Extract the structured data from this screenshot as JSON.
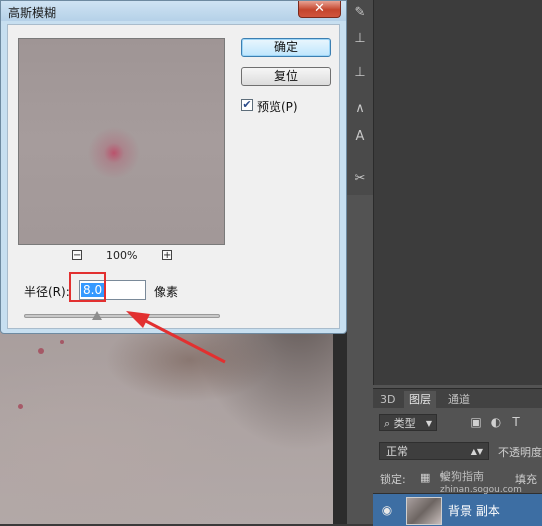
{
  "dialog": {
    "title": "高斯模糊",
    "close_glyph": "✕",
    "ok_label": "确定",
    "reset_label": "复位",
    "preview_checkbox": {
      "label": "预览(P)",
      "checked": true,
      "check_glyph": "✔"
    },
    "zoom": {
      "minus_glyph": "−",
      "value": "100%",
      "plus_glyph": "+"
    },
    "radius": {
      "label": "半径(R):",
      "value": "8.0",
      "unit": "像素",
      "slider_fraction": 0.37
    }
  },
  "layers_panel": {
    "tabs": [
      "3D",
      "图层",
      "通道"
    ],
    "active_tab": 1,
    "filter_kind": "类型",
    "blend_mode": "正常",
    "opacity_label": "不透明度",
    "lock_label": "锁定:",
    "fill_label": "填充",
    "layer": {
      "name": "背景 副本",
      "visible": true
    }
  },
  "watermark": {
    "line1": "搜狗指南",
    "line2": "zhinan.sogou.com"
  },
  "icons": {
    "close": "close-icon",
    "eye": "eye-icon",
    "search": "search-icon",
    "image_filter": "image-filter-icon",
    "adjustment_filter": "adjustment-filter-icon",
    "type_filter": "type-filter-icon",
    "lock_pixels": "lock-transparent-icon",
    "dropdown": "chevron-down-icon"
  },
  "colors": {
    "annotation_red": "#e23030",
    "selection_blue": "#3399ff",
    "layer_selected": "#3d6ea3"
  }
}
